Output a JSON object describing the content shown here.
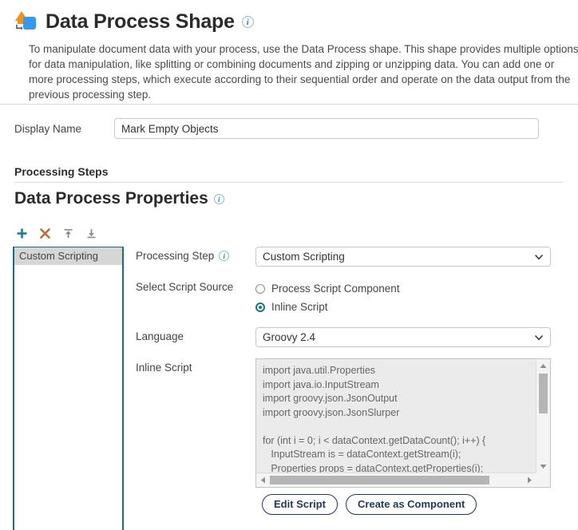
{
  "header": {
    "icon_name": "data-process-shape-icon",
    "title": "Data Process Shape",
    "info_tooltip": "i",
    "description": "To manipulate document data with your process, use the Data Process shape. This shape provides multiple options for data manipulation, like splitting or combining documents and zipping or unzipping data. You can add one or more processing steps, which execute according to their sequential order and operate on the data output from the previous processing step."
  },
  "display_name": {
    "label": "Display Name",
    "value": "Mark Empty Objects",
    "placeholder": ""
  },
  "processing_steps": {
    "section_label": "Processing Steps",
    "properties_title": "Data Process Properties",
    "properties_info": "i",
    "toolbar": [
      {
        "name": "add-step-button",
        "glyph": "+",
        "color": "#1a7f8e",
        "title": "Add"
      },
      {
        "name": "delete-step-button",
        "glyph": "✕",
        "color": "#c36a3a",
        "title": "Delete"
      },
      {
        "name": "move-step-up-button",
        "glyph": "⤒",
        "color": "#808080",
        "title": "Move Up"
      },
      {
        "name": "move-step-down-button",
        "glyph": "⤓",
        "color": "#808080",
        "title": "Move Down"
      }
    ],
    "steps": [
      {
        "label": "Custom Scripting",
        "selected": true
      }
    ]
  },
  "form": {
    "processing_step": {
      "label": "Processing Step",
      "info": "i",
      "value": "Custom Scripting",
      "options": [
        "Custom Scripting"
      ]
    },
    "script_source": {
      "label": "Select Script Source",
      "options": [
        {
          "label": "Process Script Component",
          "checked": false
        },
        {
          "label": "Inline Script",
          "checked": true
        }
      ]
    },
    "language": {
      "label": "Language",
      "value": "Groovy 2.4",
      "options": [
        "Groovy 2.4"
      ]
    },
    "inline_script": {
      "label": "Inline Script",
      "value": "import java.util.Properties\nimport java.io.InputStream\nimport groovy.json.JsonOutput\nimport groovy.json.JsonSlurper\n\nfor (int i = 0; i < dataContext.getDataCount(); i++) {\n   InputStream is = dataContext.getStream(i);\n   Properties props = dataContext.getProperties(i);"
    }
  },
  "buttons": {
    "edit_script": "Edit Script",
    "create_as_component": "Create as Component"
  },
  "colors": {
    "accent_teal": "#1a6f7e",
    "button_navy": "#1b3a5c",
    "icon_orange": "#f2901f",
    "icon_blue": "#3399f3"
  }
}
